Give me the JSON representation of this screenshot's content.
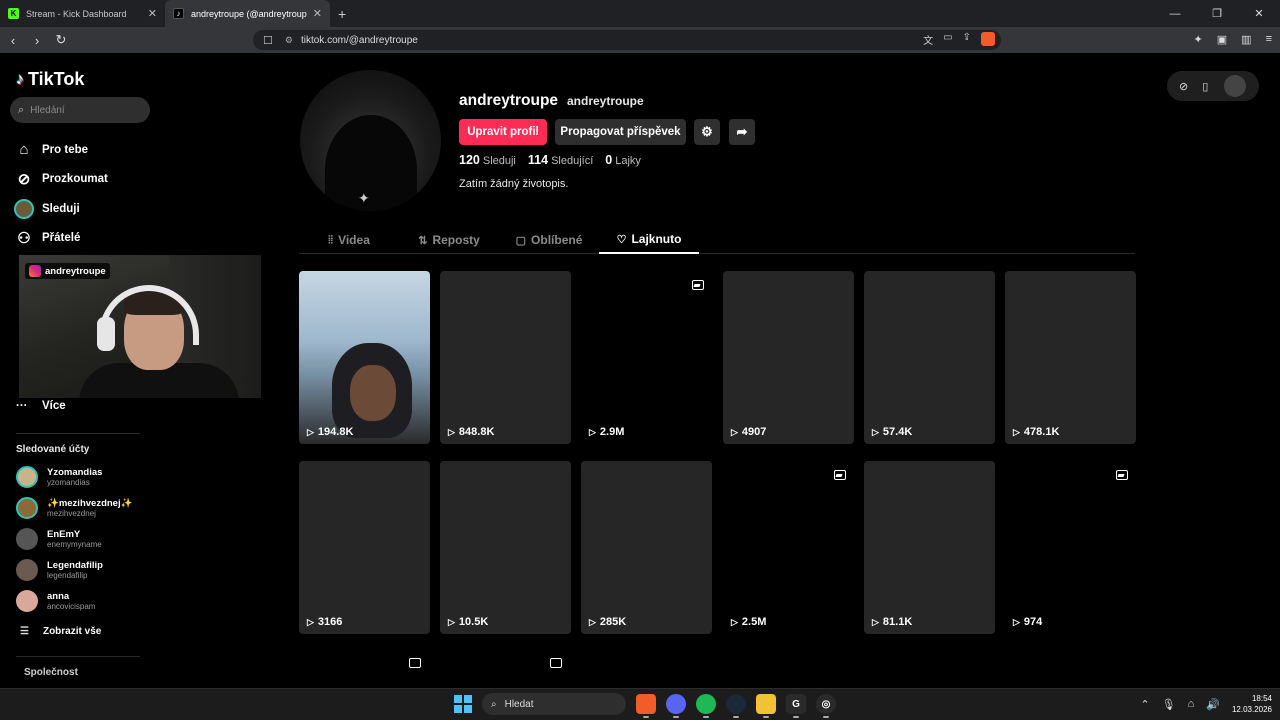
{
  "browser": {
    "tabs": [
      {
        "title": "Stream - Kick Dashboard",
        "active": false
      },
      {
        "title": "andreytroupe (@andreytroupe) |",
        "active": true
      }
    ],
    "url": "tiktok.com/@andreytroupe"
  },
  "sidebar": {
    "logo": "TikTok",
    "search_placeholder": "Hledání",
    "nav": [
      {
        "label": "Pro tebe",
        "icon": "home-icon"
      },
      {
        "label": "Prozkoumat",
        "icon": "compass-icon"
      },
      {
        "label": "Sleduji",
        "icon": "avatar"
      },
      {
        "label": "Přátelé",
        "icon": "friends-icon"
      }
    ],
    "more": "Více",
    "followed_header": "Sledované účty",
    "accounts": [
      {
        "name": "Yzomandias",
        "user": "yzomandias",
        "color": "#c9b38a",
        "ring": true
      },
      {
        "name": "✨mezihvezdnej✨",
        "user": "mezihvezdnej",
        "color": "#8a6a3a",
        "ring": true
      },
      {
        "name": "EnEmY",
        "user": "enemymyname",
        "color": "#555555",
        "ring": false
      },
      {
        "name": "Legendafilip",
        "user": "legendafilip",
        "color": "#6a5a50",
        "ring": false
      },
      {
        "name": "anna",
        "user": "ancovicispam",
        "color": "#d9a89a",
        "ring": false
      }
    ],
    "show_all": "Zobrazit vše",
    "company": "Společnost"
  },
  "webcam": {
    "tag": "andreytroupe"
  },
  "profile": {
    "username": "andreytroupe",
    "nickname": "andreytroupe",
    "edit_button": "Upravit profil",
    "promote_button": "Propagovat příspěvek",
    "following_count": "120",
    "following_label": "Sleduji",
    "followers_count": "114",
    "followers_label": "Sledující",
    "likes_count": "0",
    "likes_label": "Lajky",
    "bio": "Zatím žádný životopis."
  },
  "tabs": [
    {
      "label": "Videa",
      "icon": "⦙⦙"
    },
    {
      "label": "Reposty",
      "icon": "⇅"
    },
    {
      "label": "Oblíbené",
      "icon": "▢"
    },
    {
      "label": "Lajknuto",
      "icon": "♡",
      "active": true
    }
  ],
  "videos": [
    {
      "views": "194.8K",
      "kind": "photo"
    },
    {
      "views": "848.8K",
      "kind": "plain"
    },
    {
      "views": "2.9M",
      "kind": "blank"
    },
    {
      "views": "4907",
      "kind": "plain"
    },
    {
      "views": "57.4K",
      "kind": "plain"
    },
    {
      "views": "478.1K",
      "kind": "plain"
    },
    {
      "views": "3166",
      "kind": "plain"
    },
    {
      "views": "10.5K",
      "kind": "plain"
    },
    {
      "views": "285K",
      "kind": "plain"
    },
    {
      "views": "2.5M",
      "kind": "blank"
    },
    {
      "views": "81.1K",
      "kind": "plain"
    },
    {
      "views": "974",
      "kind": "blank"
    }
  ],
  "taskbar": {
    "search": "Hledat",
    "time": "18:54",
    "date": "12.03.2026"
  },
  "colors": {
    "accent": "#fe2c55",
    "ring": "#2ec4b6"
  }
}
